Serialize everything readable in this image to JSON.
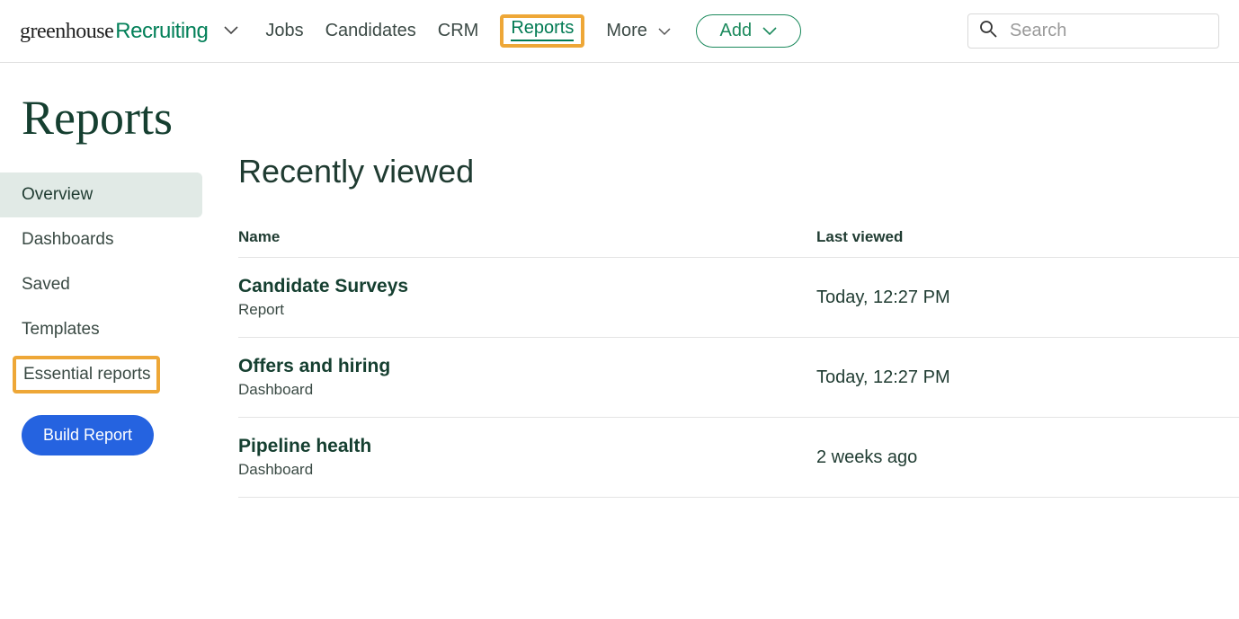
{
  "brand": {
    "name1": "greenhouse",
    "name2": "Recruiting"
  },
  "nav": {
    "jobs": "Jobs",
    "candidates": "Candidates",
    "crm": "CRM",
    "reports": "Reports",
    "more": "More",
    "add": "Add"
  },
  "search": {
    "placeholder": "Search"
  },
  "page": {
    "title": "Reports"
  },
  "sidebar": {
    "items": [
      "Overview",
      "Dashboards",
      "Saved",
      "Templates",
      "Essential reports"
    ],
    "build_label": "Build Report"
  },
  "recent": {
    "title": "Recently viewed",
    "col_name": "Name",
    "col_last": "Last viewed",
    "rows": [
      {
        "title": "Candidate Surveys",
        "type": "Report",
        "last": "Today, 12:27 PM"
      },
      {
        "title": "Offers and hiring",
        "type": "Dashboard",
        "last": "Today, 12:27 PM"
      },
      {
        "title": "Pipeline health",
        "type": "Dashboard",
        "last": "2 weeks ago"
      }
    ]
  }
}
